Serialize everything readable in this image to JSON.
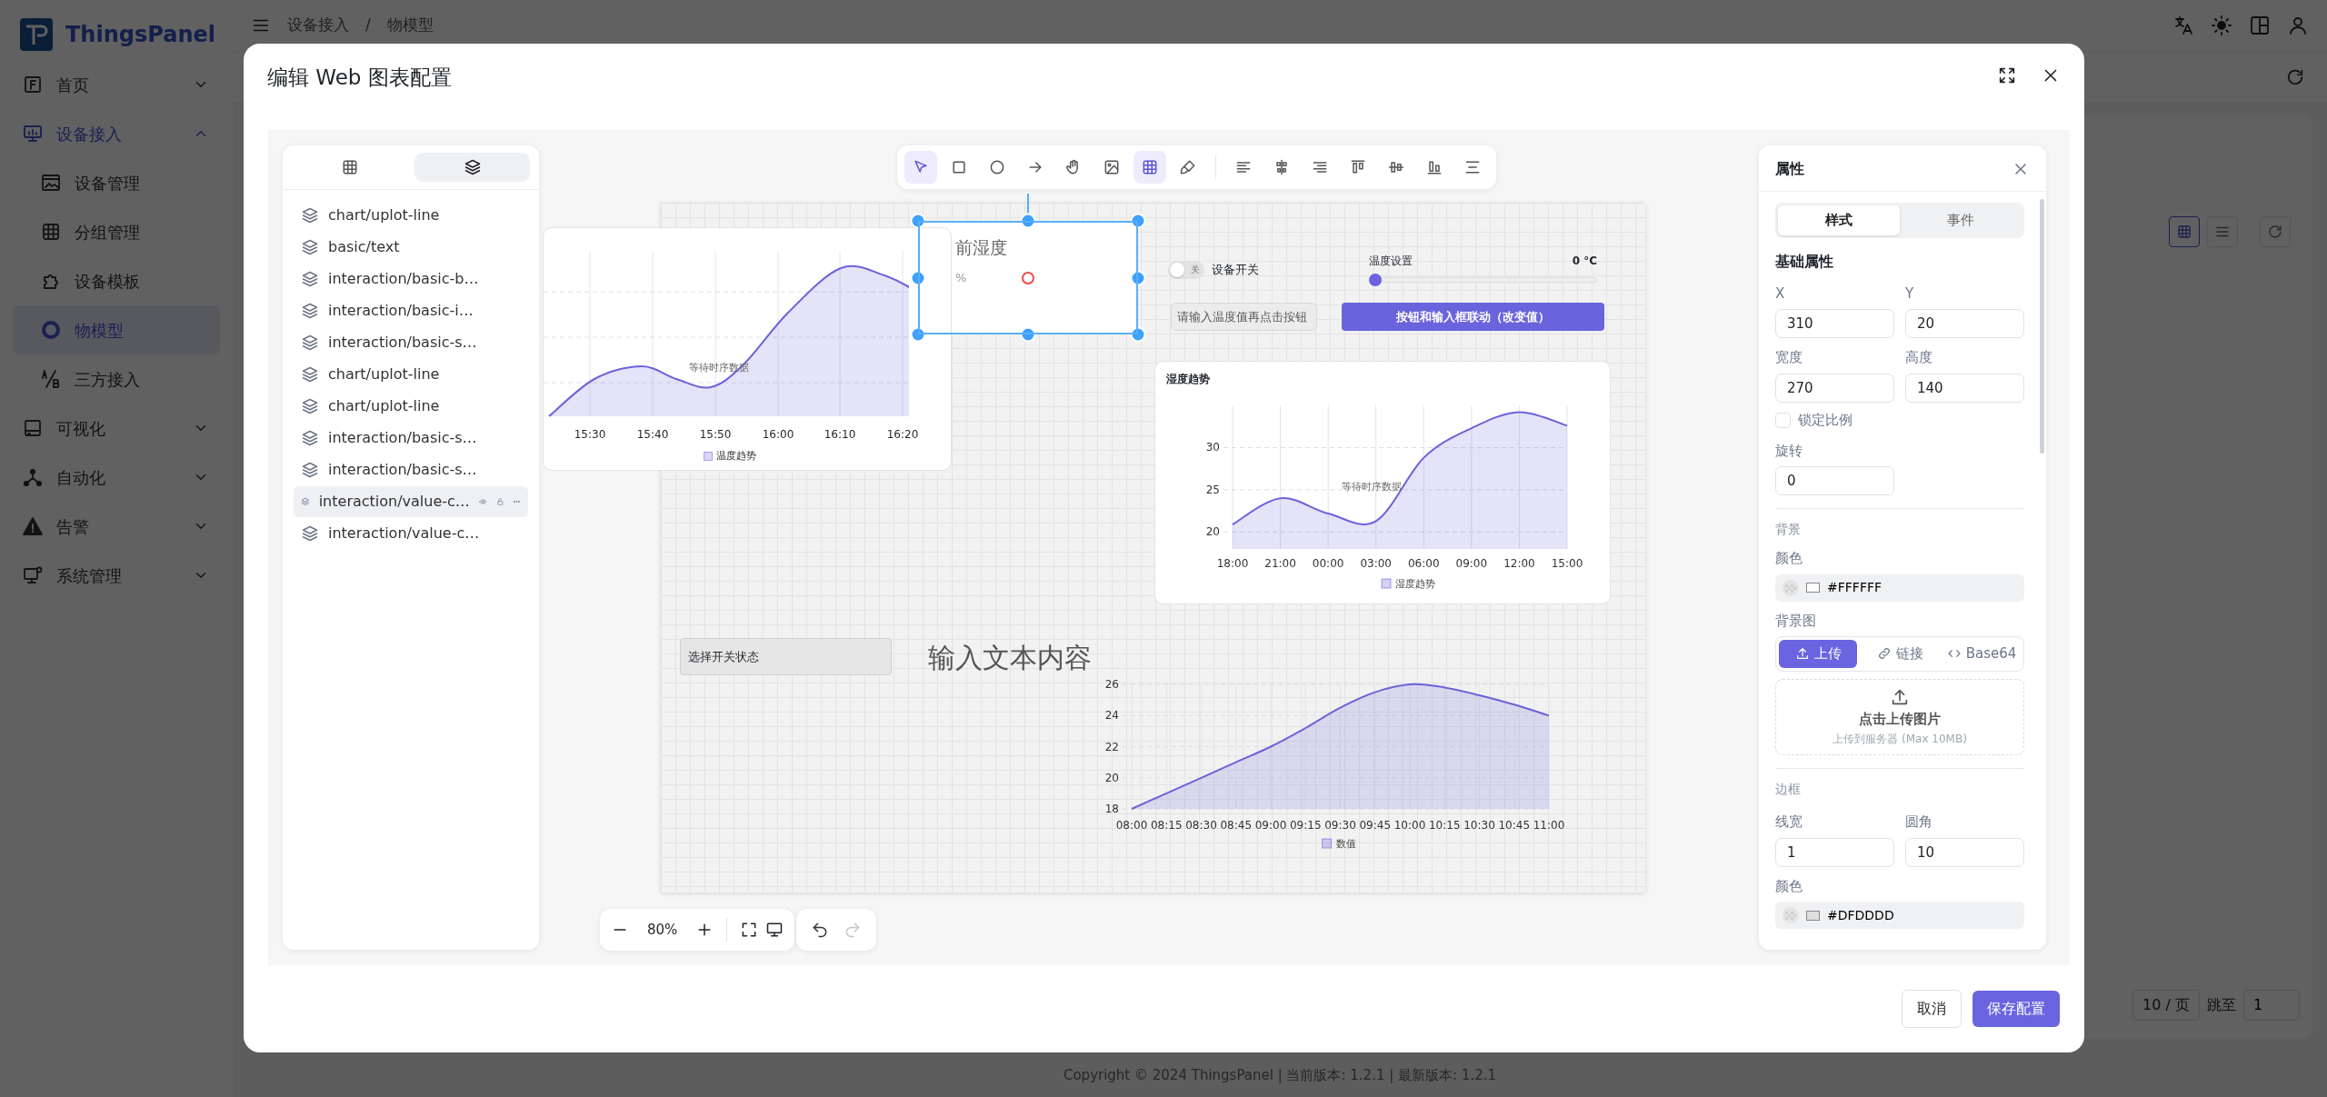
{
  "brand": {
    "name": "ThingsPanel"
  },
  "sidebar": {
    "items": [
      {
        "label": "首页",
        "selected": false,
        "expanded": false
      },
      {
        "label": "设备接入",
        "selected": true,
        "expanded": true,
        "children": [
          {
            "label": "设备管理",
            "selected": false
          },
          {
            "label": "分组管理",
            "selected": false
          },
          {
            "label": "设备模板",
            "selected": false
          },
          {
            "label": "物模型",
            "selected": true
          },
          {
            "label": "三方接入",
            "selected": false
          }
        ]
      },
      {
        "label": "可视化",
        "selected": false,
        "expanded": false
      },
      {
        "label": "自动化",
        "selected": false,
        "expanded": false
      },
      {
        "label": "告警",
        "selected": false,
        "expanded": false
      },
      {
        "label": "系统管理",
        "selected": false,
        "expanded": false
      }
    ]
  },
  "header": {
    "breadcrumb": [
      "设备接入",
      "物模型"
    ],
    "separator": "/"
  },
  "pagination": {
    "page_size": "10 / 页",
    "jump_label": "跳至",
    "jump_value": "1"
  },
  "footer": {
    "copyright": "Copyright © 2024 ThingsPanel | 当前版本: 1.2.1 | 最新版本: 1.2.1"
  },
  "dialog": {
    "title": "编辑 Web 图表配置",
    "layer_tabs": [
      {
        "selected": false
      },
      {
        "selected": true
      }
    ],
    "layers": [
      {
        "label": "chart/uplot-line",
        "selected": false
      },
      {
        "label": "basic/text",
        "selected": false
      },
      {
        "label": "interaction/basic-b…",
        "selected": false
      },
      {
        "label": "interaction/basic-i…",
        "selected": false
      },
      {
        "label": "interaction/basic-s…",
        "selected": false
      },
      {
        "label": "chart/uplot-line",
        "selected": false
      },
      {
        "label": "chart/uplot-line",
        "selected": false
      },
      {
        "label": "interaction/basic-s…",
        "selected": false
      },
      {
        "label": "interaction/basic-s…",
        "selected": false
      },
      {
        "label": "interaction/value-c…",
        "selected": true
      },
      {
        "label": "interaction/value-c…",
        "selected": false
      }
    ],
    "tools": [
      {
        "selected": true
      },
      {
        "selected": false
      },
      {
        "selected": false
      },
      {
        "selected": false
      },
      {
        "selected": false
      },
      {
        "selected": false
      },
      {
        "selected": true
      },
      {
        "selected": false
      }
    ],
    "canvas": {
      "elements": [
        {
          "kind": "trend",
          "x_labels": [
            "15:30",
            "15:40",
            "15:50",
            "16:00",
            "16:10",
            "16:20"
          ],
          "status": "等待时序数据",
          "legend": "温度趋势"
        },
        {
          "kind": "metric",
          "title": "前湿度",
          "unit": "%",
          "selected": true
        },
        {
          "kind": "switch",
          "label": "设备开关",
          "state_text": "关",
          "on": false
        },
        {
          "kind": "slider",
          "label": "温度设置",
          "reading": "0 °C",
          "level": 0
        },
        {
          "kind": "input",
          "placeholder": "请输入温度值再点击按钮"
        },
        {
          "kind": "button",
          "label": "按钮和输入框联动（改变值）"
        },
        {
          "kind": "chart",
          "title": "湿度趋势",
          "status": "等待时序数据",
          "chart_data": {
            "type": "area",
            "x": [
              "18:00",
              "21:00",
              "00:00",
              "03:00",
              "06:00",
              "09:00",
              "12:00",
              "15:00"
            ],
            "ylim": [
              18,
              35
            ],
            "yticks": [
              20,
              25,
              30
            ],
            "grid": true,
            "series": [
              {
                "name": "湿度趋势",
                "color": "#6c63d9",
                "values": [
                  20.9,
                  24.0,
                  22.2,
                  21.3,
                  28.8,
                  32.3,
                  34.2,
                  32.6
                ]
              }
            ]
          }
        },
        {
          "kind": "select",
          "placeholder": "选择开关状态"
        },
        {
          "kind": "text",
          "text": "输入文本内容"
        },
        {
          "kind": "chart",
          "chart_data": {
            "type": "area",
            "x": [
              "08:00",
              "08:15",
              "08:30",
              "08:45",
              "09:00",
              "09:15",
              "09:30",
              "09:45",
              "10:00",
              "10:15",
              "10:30",
              "10:45",
              "11:00"
            ],
            "ylim": [
              18,
              26
            ],
            "yticks": [
              18,
              20,
              22,
              24,
              26
            ],
            "grid": true,
            "series": [
              {
                "name": "数值",
                "color": "#6c63d9",
                "values": [
                  18,
                  19,
                  20,
                  21,
                  22,
                  23.2,
                  24.5,
                  25.5,
                  26,
                  25.8,
                  25.3,
                  24.7,
                  24
                ]
              }
            ]
          }
        }
      ]
    },
    "zoom": {
      "value": "80%"
    },
    "history": {
      "undo_disabled": false,
      "redo_disabled": true
    },
    "properties": {
      "title": "属性",
      "tabs": [
        {
          "label": "样式",
          "selected": true
        },
        {
          "label": "事件",
          "selected": false
        }
      ],
      "basic_title": "基础属性",
      "fields": [
        {
          "label": "X",
          "value": "310"
        },
        {
          "label": "Y",
          "value": "20"
        },
        {
          "label": "宽度",
          "value": "270"
        },
        {
          "label": "高度",
          "value": "140"
        }
      ],
      "lock_ratio": {
        "label": "锁定比例",
        "checked": false
      },
      "rotation": {
        "label": "旋转",
        "value": "0"
      },
      "background": {
        "section": "背景",
        "color_label": "颜色",
        "color_value": "#FFFFFF",
        "image_label": "背景图",
        "sources": [
          {
            "label": "上传",
            "selected": true
          },
          {
            "label": "链接",
            "selected": false
          },
          {
            "label": "Base64",
            "selected": false
          }
        ],
        "upload_title": "点击上传图片",
        "upload_hint": "上传到服务器 (Max 10MB)"
      },
      "border": {
        "section": "边框",
        "fields": [
          {
            "label": "线宽",
            "value": "1"
          },
          {
            "label": "圆角",
            "value": "10"
          }
        ],
        "color_label": "颜色",
        "color_value": "#DFDDDD"
      }
    },
    "buttons": [
      {
        "label": "取消",
        "kind": "secondary"
      },
      {
        "label": "保存配置",
        "kind": "primary"
      }
    ]
  }
}
